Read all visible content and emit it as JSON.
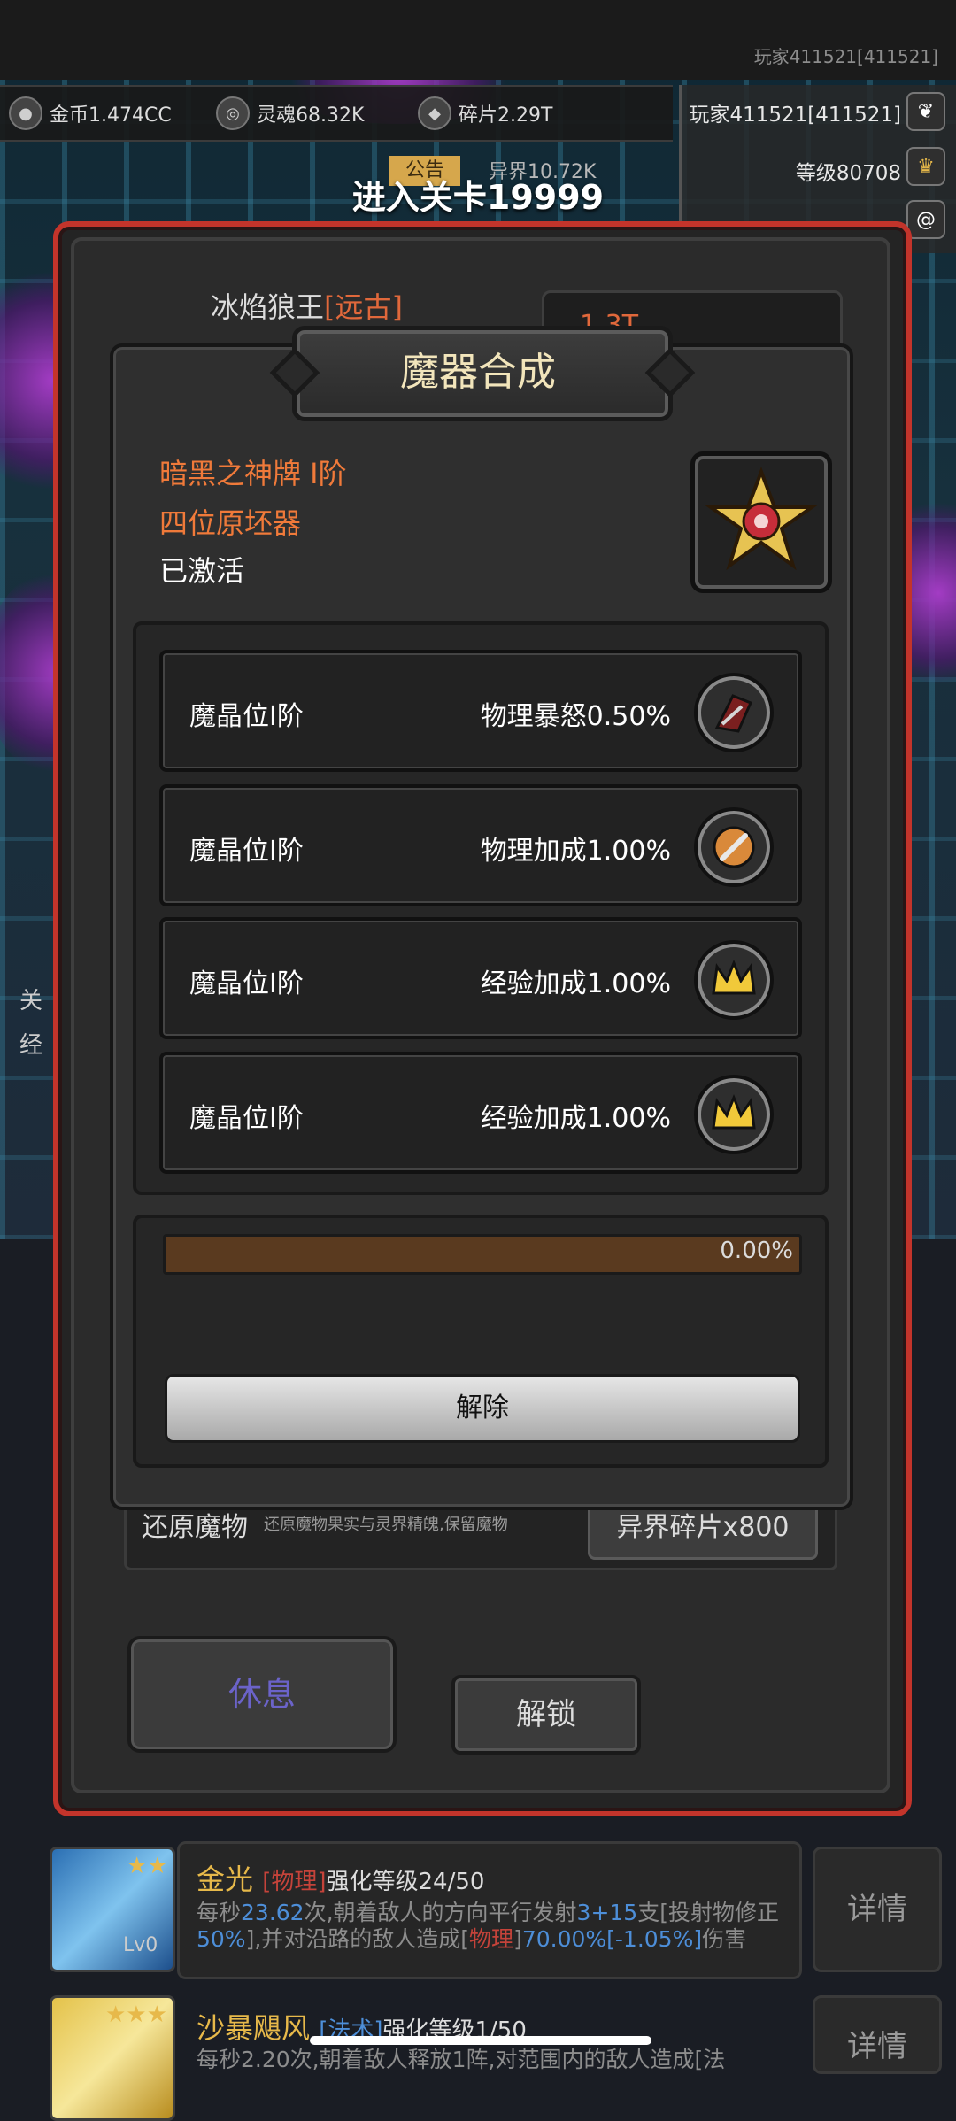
{
  "header": {
    "player_small": "玩家411521[411521]",
    "resources": [
      {
        "icon": "gold-coin-icon",
        "label": "金币1.474CC"
      },
      {
        "icon": "soul-icon",
        "label": "灵魂68.32K"
      },
      {
        "icon": "shard-icon",
        "label": "碎片2.29T"
      }
    ],
    "player": {
      "name": "玩家411521[411521]",
      "level": "等级80708"
    },
    "notice_tab": "公告",
    "otherworld": "异界10.72K",
    "stage_title": "进入关卡19999"
  },
  "monster": {
    "name": "冰焰狼王",
    "tier": "[远古]",
    "power": "1.3T"
  },
  "modal": {
    "title": "魔器合成",
    "artifact_name": "暗黑之神牌 I阶",
    "artifact_type": "四位原坯器",
    "artifact_status": "已激活",
    "slots": [
      {
        "name": "魔晶位I阶",
        "attr": "物理暴怒0.50%",
        "icon": "claw-icon"
      },
      {
        "name": "魔晶位I阶",
        "attr": "物理加成1.00%",
        "icon": "sword-icon"
      },
      {
        "name": "魔晶位I阶",
        "attr": "经验加成1.00%",
        "icon": "crown-icon"
      },
      {
        "name": "魔晶位I阶",
        "attr": "经验加成1.00%",
        "icon": "crown-icon"
      }
    ],
    "progress": {
      "value": 0.0,
      "label": "0.00%"
    },
    "release_button": "解除"
  },
  "restore": {
    "title": "还原魔物",
    "desc": "还原魔物果实与灵界精魄,保留魔物",
    "cost_button": "异界碎片x800"
  },
  "actions": {
    "rest_button": "休息",
    "unlock_button": "解锁"
  },
  "skills": [
    {
      "name": "金光",
      "tag": "[物理]",
      "level": "强化等级24/50",
      "lv": "Lv0",
      "detail": "详情",
      "desc_a": "每秒",
      "desc_b": "23.62",
      "desc_c": "次,朝着敌人的方向平行发射",
      "desc_d": "3+15",
      "desc_e": "支[投射物修正",
      "desc_f": "50%",
      "desc_g": "],并对沿路的敌人造成[",
      "desc_h": "物理",
      "desc_i": "]",
      "desc_j": "70.00%[-1.05%]",
      "desc_k": "伤害"
    },
    {
      "name": "沙暴飓风",
      "tag": "[法术]",
      "level": "强化等级1/50",
      "detail": "详情",
      "desc": "每秒2.20次,朝着敌人释放1阵,对范围内的敌人造成[法"
    }
  ],
  "colors": {
    "accent_red": "#c3342b",
    "artifact_orange": "#f07a3a",
    "title_cream": "#f2e5bb",
    "skill_gold": "#e7b94a"
  }
}
